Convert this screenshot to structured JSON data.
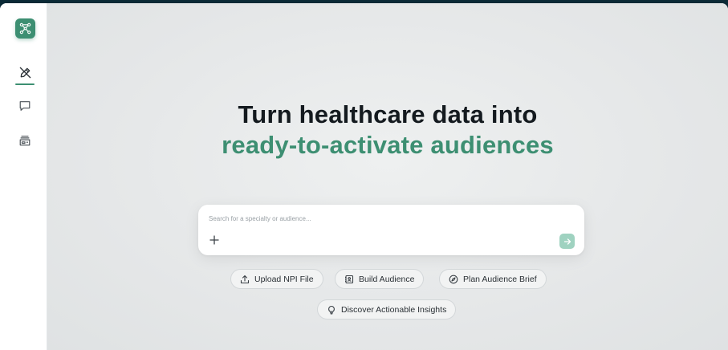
{
  "sidebar": {
    "logo_icon": "network-graph-icon",
    "items": [
      {
        "name": "new-audience",
        "icon": "pencil-slash-icon",
        "active": true
      },
      {
        "name": "chat",
        "icon": "chat-bubble-icon",
        "active": false
      },
      {
        "name": "library",
        "icon": "archive-box-icon",
        "active": false
      }
    ]
  },
  "hero": {
    "line1": "Turn healthcare data into",
    "line2": "ready-to-activate audiences"
  },
  "search": {
    "placeholder": "Search for a specialty or audience...",
    "value": ""
  },
  "actions": [
    {
      "label": "Upload NPI File",
      "icon": "upload-icon"
    },
    {
      "label": "Build Audience",
      "icon": "contact-book-icon"
    },
    {
      "label": "Plan Audience Brief",
      "icon": "compass-icon"
    },
    {
      "label": "Discover Actionable Insights",
      "icon": "lightbulb-icon"
    }
  ],
  "colors": {
    "accent": "#3d8f72",
    "accent_light": "#9fd2c0",
    "heading": "#141a1f",
    "frame": "#0b2a36"
  }
}
